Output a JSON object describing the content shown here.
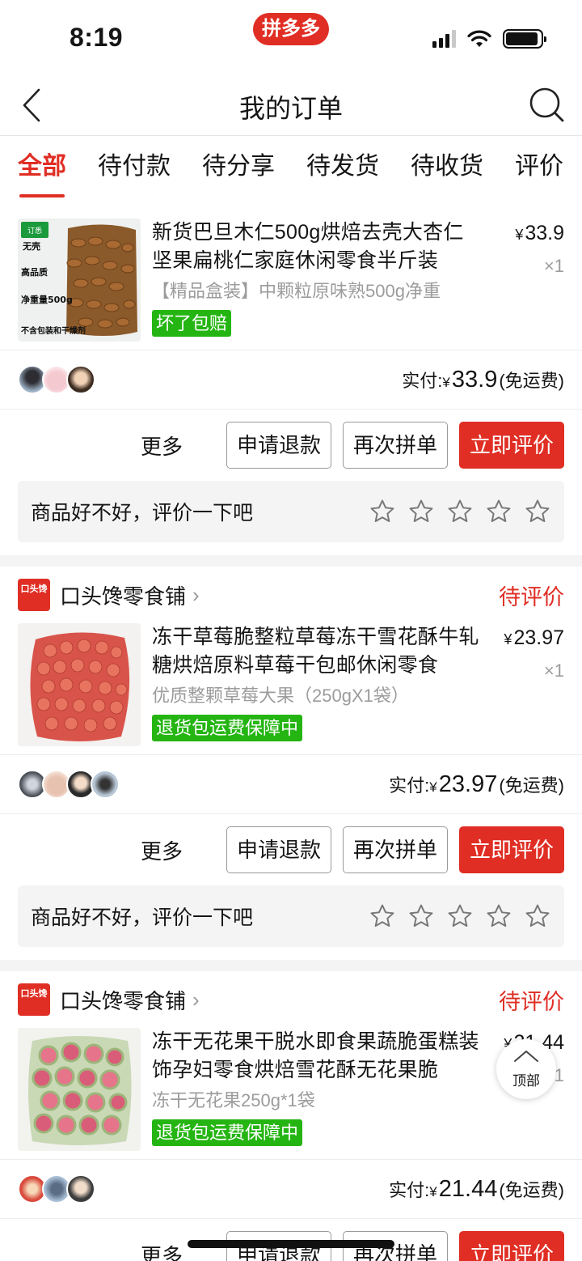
{
  "status_bar": {
    "time": "8:19",
    "app_badge": "拼多多",
    "battery_level": 0.92
  },
  "nav": {
    "title": "我的订单"
  },
  "tabs": [
    {
      "label": "全部",
      "active": true
    },
    {
      "label": "待付款"
    },
    {
      "label": "待分享"
    },
    {
      "label": "待发货"
    },
    {
      "label": "待收货"
    },
    {
      "label": "评价"
    }
  ],
  "orders": [
    {
      "shop": "",
      "status": "",
      "title": "新货巴旦木仁500g烘焙去壳大杏仁坚果扁桃仁家庭休闲零食半斤装",
      "spec": "【精品盒装】中颗粒原味熟500g净重",
      "tag": "坏了包赔",
      "price": "33.9",
      "qty": "×1",
      "paid_label": "实付:",
      "paid_amount": "33.9",
      "shipping": "(免运费)",
      "image_labels": [
        "无壳",
        "高品质",
        "净重量500g",
        "不含包装和干燥剂",
        "订悉"
      ]
    },
    {
      "shop": "口头馋零食铺",
      "status": "待评价",
      "title": "冻干草莓脆整粒草莓冻干雪花酥牛轧糖烘焙原料草莓干包邮休闲零食",
      "spec": "优质整颗草莓大果（250gX1袋）",
      "tag": "退货包运费保障中",
      "price": "23.97",
      "qty": "×1",
      "paid_label": "实付:",
      "paid_amount": "23.97",
      "shipping": "(免运费)"
    },
    {
      "shop": "口头馋零食铺",
      "status": "待评价",
      "title": "冻干无花果干脱水即食果蔬脆蛋糕装饰孕妇零食烘焙雪花酥无花果脆",
      "spec": "冻干无花果250g*1袋",
      "tag": "退货包运费保障中",
      "price": "21.44",
      "qty": "×1",
      "paid_label": "实付:",
      "paid_amount": "21.44",
      "shipping": "(免运费)"
    }
  ],
  "actions": {
    "more": "更多",
    "refund": "申请退款",
    "reorder": "再次拼单",
    "review": "立即评价"
  },
  "review_prompt": "商品好不好，评价一下吧",
  "shop_logo_text": "口头馋",
  "currency": "¥",
  "float": {
    "top_label": "顶部"
  },
  "colors": {
    "accent": "#e02e24",
    "tag_green": "#25b513"
  }
}
